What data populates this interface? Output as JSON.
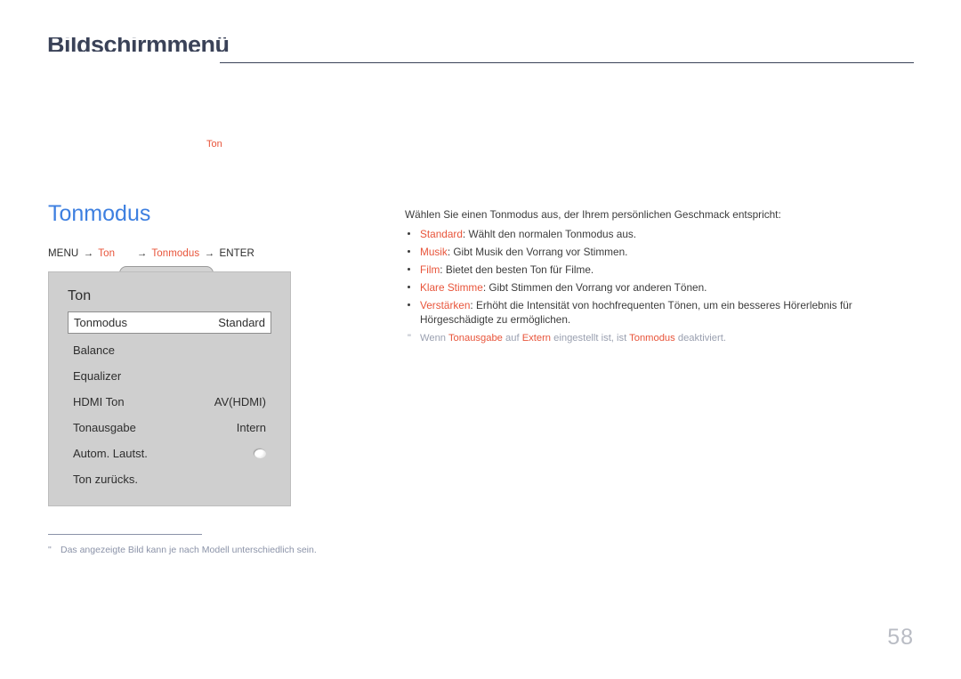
{
  "header": {
    "chapter_heading": "Bildschirmmenü",
    "rule": "header-divider"
  },
  "breadcrumb_top": {
    "label": "Ton"
  },
  "page": {
    "title": "Tonmodus",
    "number": "58"
  },
  "menu_path": {
    "menu": "MENU",
    "arrow": "→",
    "item1": "Ton",
    "item2": "Tonmodus",
    "enter": "ENTER"
  },
  "osd": {
    "title": "Ton",
    "rows": [
      {
        "label": "Tonmodus",
        "value": "Standard",
        "selected": true,
        "control": "text"
      },
      {
        "label": "Balance",
        "value": "",
        "selected": false,
        "control": "none"
      },
      {
        "label": "Equalizer",
        "value": "",
        "selected": false,
        "control": "none"
      },
      {
        "label": "HDMI Ton",
        "value": "AV(HDMI)",
        "selected": false,
        "control": "text"
      },
      {
        "label": "Tonausgabe",
        "value": "Intern",
        "selected": false,
        "control": "text"
      },
      {
        "label": "Autom. Lautst.",
        "value": "",
        "selected": false,
        "control": "toggle"
      },
      {
        "label": "Ton zurücks.",
        "value": "",
        "selected": false,
        "control": "none"
      }
    ]
  },
  "left_footnote": {
    "marker": "\"",
    "text": "Das angezeigte Bild kann je nach Modell unterschiedlich sein."
  },
  "content": {
    "intro": "Wählen Sie einen Tonmodus aus, der Ihrem persönlichen Geschmack entspricht:",
    "bullets": [
      {
        "term": "Standard",
        "desc": ": Wählt den normalen Tonmodus aus."
      },
      {
        "term": "Musik",
        "desc": ": Gibt Musik den Vorrang vor Stimmen."
      },
      {
        "term": "Film",
        "desc": ": Bietet den besten Ton für Filme."
      },
      {
        "term": "Klare Stimme",
        "desc": ": Gibt Stimmen den Vorrang vor anderen Tönen."
      },
      {
        "term": "Verstärken",
        "desc": ": Erhöht die Intensität von hochfrequenten Tönen, um ein besseres Hörerlebnis für Hörgeschädigte zu ermöglichen."
      }
    ],
    "note": {
      "marker": "\"",
      "part1": "Wenn ",
      "accent1": "Tonausgabe",
      "part2": " auf ",
      "accent2": "Extern",
      "part3": " eingestellt ist, ist ",
      "accent3": "Tonmodus",
      "part4": " deaktiviert."
    }
  },
  "colors": {
    "accent_orange": "#e8543a",
    "title_blue": "#3d7fe0",
    "header_navy": "#3a4258",
    "note_gray": "#9aa0b0",
    "osd_bg": "#cfcfcf",
    "page_number_gray": "#b9bcc4"
  }
}
